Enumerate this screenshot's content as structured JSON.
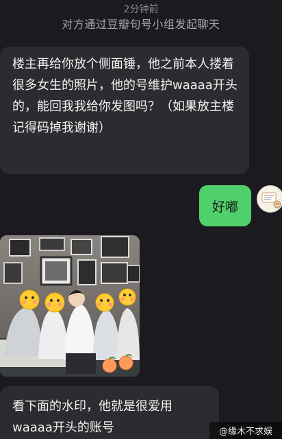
{
  "header": {
    "time_label": "2分钟前",
    "system_notice": "对方通过豆瓣句号小组发起聊天"
  },
  "messages": [
    {
      "side": "left",
      "text": "楼主再给你放个侧面锤，他之前本人搂着很多女生的照片，他的号维护waaaa开头的，能回我我给你发图吗？（如果放主楼记得码掉我谢谢）"
    },
    {
      "side": "right",
      "text": "好嘟"
    },
    {
      "side": "left",
      "type": "image",
      "alt": "group-photo"
    },
    {
      "side": "left",
      "text": "看下面的水印，他就是很爱用waaaa开头的账号"
    }
  ],
  "watermark": "@缘木不求娱",
  "colors": {
    "background": "#1b1b1f",
    "incoming_bubble": "#2c2c30",
    "outgoing_bubble": "#4fd06a"
  }
}
